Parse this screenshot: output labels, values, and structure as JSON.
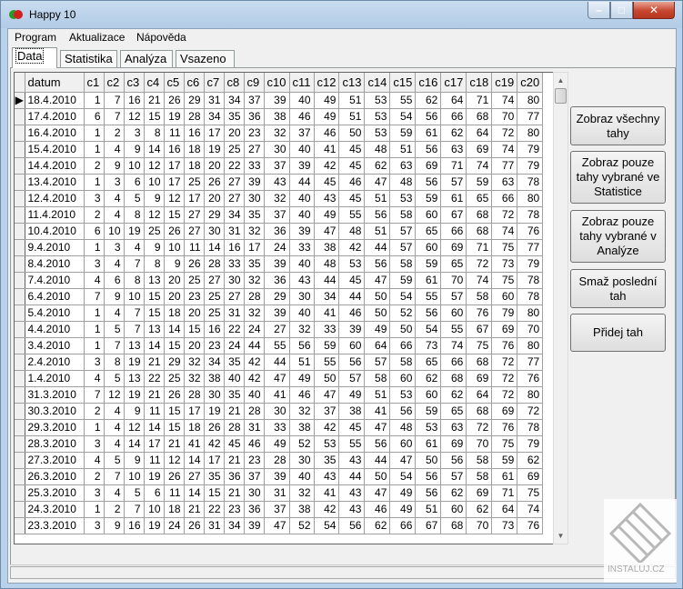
{
  "window": {
    "title": "Happy 10",
    "min_label": "–",
    "max_label": "□",
    "close_label": "✕"
  },
  "menu": {
    "program": "Program",
    "aktualizace": "Aktualizace",
    "napoveda": "Nápověda"
  },
  "tabs": [
    "Data",
    "Statistika",
    "Analýza",
    "Vsazeno"
  ],
  "grid": {
    "columns": [
      "datum",
      "c1",
      "c2",
      "c3",
      "c4",
      "c5",
      "c6",
      "c7",
      "c8",
      "c9",
      "c10",
      "c11",
      "c12",
      "c13",
      "c14",
      "c15",
      "c16",
      "c17",
      "c18",
      "c19",
      "c20"
    ],
    "rows": [
      [
        "18.4.2010",
        1,
        7,
        16,
        21,
        26,
        29,
        31,
        34,
        37,
        39,
        40,
        49,
        51,
        53,
        55,
        62,
        64,
        71,
        74,
        80
      ],
      [
        "17.4.2010",
        6,
        7,
        12,
        15,
        19,
        28,
        34,
        35,
        36,
        38,
        46,
        49,
        51,
        53,
        54,
        56,
        66,
        68,
        70,
        77
      ],
      [
        "16.4.2010",
        1,
        2,
        3,
        8,
        11,
        16,
        17,
        20,
        23,
        32,
        37,
        46,
        50,
        53,
        59,
        61,
        62,
        64,
        72,
        80
      ],
      [
        "15.4.2010",
        1,
        4,
        9,
        14,
        16,
        18,
        19,
        25,
        27,
        30,
        40,
        41,
        45,
        48,
        51,
        56,
        63,
        69,
        74,
        79
      ],
      [
        "14.4.2010",
        2,
        9,
        10,
        12,
        17,
        18,
        20,
        22,
        33,
        37,
        39,
        42,
        45,
        62,
        63,
        69,
        71,
        74,
        77,
        79
      ],
      [
        "13.4.2010",
        1,
        3,
        6,
        10,
        17,
        25,
        26,
        27,
        39,
        43,
        44,
        45,
        46,
        47,
        48,
        56,
        57,
        59,
        63,
        78
      ],
      [
        "12.4.2010",
        3,
        4,
        5,
        9,
        12,
        17,
        20,
        27,
        30,
        32,
        40,
        43,
        45,
        51,
        53,
        59,
        61,
        65,
        66,
        80
      ],
      [
        "11.4.2010",
        2,
        4,
        8,
        12,
        15,
        27,
        29,
        34,
        35,
        37,
        40,
        49,
        55,
        56,
        58,
        60,
        67,
        68,
        72,
        78
      ],
      [
        "10.4.2010",
        6,
        10,
        19,
        25,
        26,
        27,
        30,
        31,
        32,
        36,
        39,
        47,
        48,
        51,
        57,
        65,
        66,
        68,
        74,
        76
      ],
      [
        "9.4.2010",
        1,
        3,
        4,
        9,
        10,
        11,
        14,
        16,
        17,
        24,
        33,
        38,
        42,
        44,
        57,
        60,
        69,
        71,
        75,
        77
      ],
      [
        "8.4.2010",
        3,
        4,
        7,
        8,
        9,
        26,
        28,
        33,
        35,
        39,
        40,
        48,
        53,
        56,
        58,
        59,
        65,
        72,
        73,
        79
      ],
      [
        "7.4.2010",
        4,
        6,
        8,
        13,
        20,
        25,
        27,
        30,
        32,
        36,
        43,
        44,
        45,
        47,
        59,
        61,
        70,
        74,
        75,
        78
      ],
      [
        "6.4.2010",
        7,
        9,
        10,
        15,
        20,
        23,
        25,
        27,
        28,
        29,
        30,
        34,
        44,
        50,
        54,
        55,
        57,
        58,
        60,
        78
      ],
      [
        "5.4.2010",
        1,
        4,
        7,
        15,
        18,
        20,
        25,
        31,
        32,
        39,
        40,
        41,
        46,
        50,
        52,
        56,
        60,
        76,
        79,
        80
      ],
      [
        "4.4.2010",
        1,
        5,
        7,
        13,
        14,
        15,
        16,
        22,
        24,
        27,
        32,
        33,
        39,
        49,
        50,
        54,
        55,
        67,
        69,
        70
      ],
      [
        "3.4.2010",
        1,
        7,
        13,
        14,
        15,
        20,
        23,
        24,
        44,
        55,
        56,
        59,
        60,
        64,
        66,
        73,
        74,
        75,
        76,
        80
      ],
      [
        "2.4.2010",
        3,
        8,
        19,
        21,
        29,
        32,
        34,
        35,
        42,
        44,
        51,
        55,
        56,
        57,
        58,
        65,
        66,
        68,
        72,
        77
      ],
      [
        "1.4.2010",
        4,
        5,
        13,
        22,
        25,
        32,
        38,
        40,
        42,
        47,
        49,
        50,
        57,
        58,
        60,
        62,
        68,
        69,
        72,
        76
      ],
      [
        "31.3.2010",
        7,
        12,
        19,
        21,
        26,
        28,
        30,
        35,
        40,
        41,
        46,
        47,
        49,
        51,
        53,
        60,
        62,
        64,
        72,
        80
      ],
      [
        "30.3.2010",
        2,
        4,
        9,
        11,
        15,
        17,
        19,
        21,
        28,
        30,
        32,
        37,
        38,
        41,
        56,
        59,
        65,
        68,
        69,
        72
      ],
      [
        "29.3.2010",
        1,
        4,
        12,
        14,
        15,
        18,
        26,
        28,
        31,
        33,
        38,
        42,
        45,
        47,
        48,
        53,
        63,
        72,
        76,
        78
      ],
      [
        "28.3.2010",
        3,
        4,
        14,
        17,
        21,
        41,
        42,
        45,
        46,
        49,
        52,
        53,
        55,
        56,
        60,
        61,
        69,
        70,
        75,
        79
      ],
      [
        "27.3.2010",
        4,
        5,
        9,
        11,
        12,
        14,
        17,
        21,
        23,
        28,
        30,
        35,
        43,
        44,
        47,
        50,
        56,
        58,
        59,
        62
      ],
      [
        "26.3.2010",
        2,
        7,
        10,
        19,
        26,
        27,
        35,
        36,
        37,
        39,
        40,
        43,
        44,
        50,
        54,
        56,
        57,
        58,
        61,
        69
      ],
      [
        "25.3.2010",
        3,
        4,
        5,
        6,
        11,
        14,
        15,
        21,
        30,
        31,
        32,
        41,
        43,
        47,
        49,
        56,
        62,
        69,
        71,
        75
      ],
      [
        "24.3.2010",
        1,
        2,
        7,
        10,
        18,
        21,
        22,
        23,
        36,
        37,
        38,
        42,
        43,
        46,
        49,
        51,
        60,
        62,
        64,
        74
      ],
      [
        "23.3.2010",
        3,
        9,
        16,
        19,
        24,
        26,
        31,
        34,
        39,
        47,
        52,
        54,
        56,
        62,
        66,
        67,
        68,
        70,
        73,
        76
      ]
    ]
  },
  "buttons": {
    "show_all": "Zobraz všechny tahy",
    "show_stats": "Zobraz pouze tahy vybrané ve Statistice",
    "show_analysis": "Zobraz pouze tahy vybrané v Analýze",
    "delete_last": "Smaž poslední tah",
    "add_draw": "Přidej tah"
  },
  "watermark": "INSTALUJ.CZ"
}
